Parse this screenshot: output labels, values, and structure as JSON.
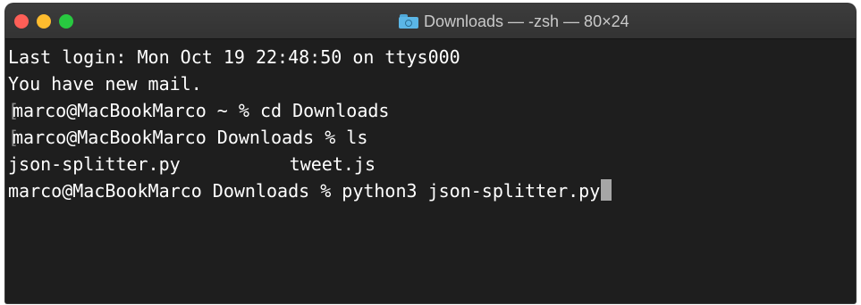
{
  "window": {
    "title": "Downloads — -zsh — 80×24",
    "title_icon": "folder-icon"
  },
  "terminal": {
    "lines": [
      {
        "marked": false,
        "text": "Last login: Mon Oct 19 22:48:50 on ttys000"
      },
      {
        "marked": false,
        "text": "You have new mail."
      },
      {
        "marked": true,
        "text": "marco@MacBookMarco ~ % cd Downloads"
      },
      {
        "marked": true,
        "text": "marco@MacBookMarco Downloads % ls"
      },
      {
        "marked": false,
        "files": [
          "json-splitter.py",
          "tweet.js"
        ]
      },
      {
        "marked": false,
        "text": "marco@MacBookMarco Downloads % python3 json-splitter.py",
        "cursor": true
      }
    ]
  },
  "colors": {
    "background": "#1e1e1e",
    "text": "#ffffff",
    "titlebar": "#383838",
    "close": "#fe5f57",
    "minimize": "#febc2e",
    "zoom": "#28c840"
  }
}
